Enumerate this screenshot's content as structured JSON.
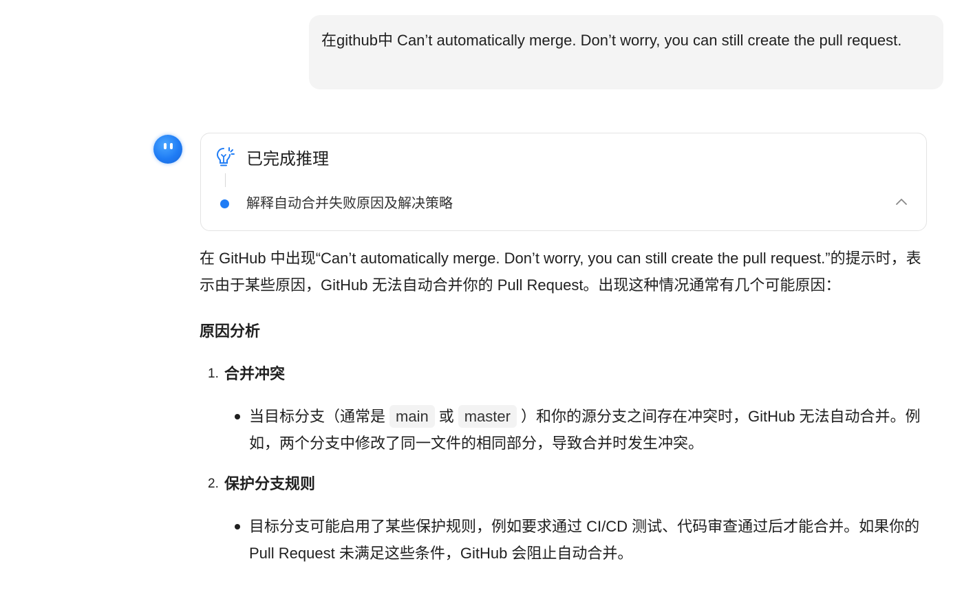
{
  "user_message": {
    "text": "在github中 Can’t automatically merge. Don’t worry, you can still create the pull request."
  },
  "assistant": {
    "reasoning": {
      "title": "已完成推理",
      "step": "解释自动合并失败原因及解决策略"
    },
    "intro": "在 GitHub 中出现“Can’t automatically merge. Don’t worry, you can still create the pull request.”的提示时，表示由于某些原因，GitHub 无法自动合并你的 Pull Request。出现这种情况通常有几个可能原因：",
    "section_heading": "原因分析",
    "items": [
      {
        "number": "1.",
        "title": "合并冲突",
        "bullet_prefix": "当目标分支（通常是",
        "code_1": "main",
        "bullet_mid": "或",
        "code_2": "master",
        "bullet_suffix": "）和你的源分支之间存在冲突时，GitHub 无法自动合并。例如，两个分支中修改了同一文件的相同部分，导致合并时发生冲突。"
      },
      {
        "number": "2.",
        "title": "保护分支规则",
        "bullet": "目标分支可能启用了某些保护规则，例如要求通过 CI/CD 测试、代码审查通过后才能合并。如果你的 Pull Request 未满足这些条件，GitHub 会阻止自动合并。"
      }
    ]
  },
  "colors": {
    "accent": "#1f7cf5",
    "user_bubble_bg": "#f4f4f4",
    "card_border": "#e3e3e3"
  },
  "icons": [
    "avatar-icon",
    "lightbulb-icon",
    "chevron-up-icon"
  ]
}
